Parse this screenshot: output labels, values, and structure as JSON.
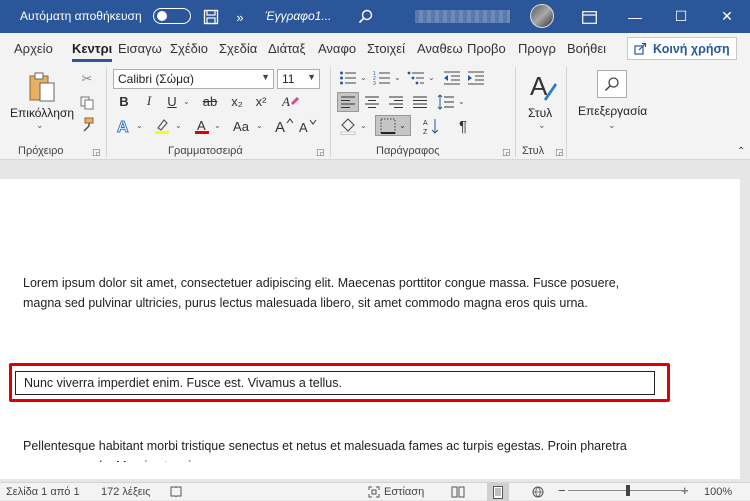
{
  "titlebar": {
    "autosave_label": "Αυτόματη αποθήκευση",
    "doc_title": "Έγγραφο1...",
    "save_icon": "save-icon",
    "more_icon": "chevron-double-right-icon",
    "search_icon": "search-icon",
    "minimize": "—",
    "restore": "☐",
    "close": "✕"
  },
  "tabs": {
    "items": [
      "Αρχείο",
      "Κεντρι",
      "Εισαγω",
      "Σχέδιο",
      "Σχεδία",
      "Διάταξ",
      "Αναφο",
      "Στοιχεί",
      "Αναθεω",
      "Προβο",
      "Προγρ",
      "Βοήθει"
    ],
    "active": "Κεντρι",
    "share_label": "Κοινή χρήση"
  },
  "ribbon": {
    "clipboard": {
      "paste_label": "Επικόλληση",
      "group_label": "Πρόχειρο"
    },
    "font": {
      "font_name": "Calibri (Σώμα)",
      "font_size": "11",
      "bold": "B",
      "italic": "I",
      "underline": "U",
      "strike": "ab",
      "subscript": "x₂",
      "superscript": "x²",
      "case_label": "Aa",
      "grow": "A^",
      "shrink": "Aˇ",
      "group_label": "Γραμματοσειρά",
      "highlight_color": "#ffff00",
      "font_color": "#e00000"
    },
    "paragraph": {
      "group_label": "Παράγραφος",
      "pilcrow": "¶"
    },
    "styles": {
      "label": "Στυλ",
      "group_label": "Στυλ"
    },
    "editing": {
      "label": "Επεξεργασία"
    }
  },
  "document": {
    "paragraph1": "Lorem ipsum dolor sit amet, consectetuer adipiscing elit. Maecenas porttitor congue massa. Fusce posuere, magna sed pulvinar ultricies, purus lectus malesuada libero, sit amet commodo magna eros quis urna.",
    "paragraph2": "Nunc viverra imperdiet enim. Fusce est. Vivamus a tellus.",
    "paragraph3": "Pellentesque habitant morbi tristique senectus et netus et malesuada fames ac turpis egestas. Proin pharetra nonummy pede. Mauris et orci."
  },
  "status": {
    "page": "Σελίδα 1 από 1",
    "words": "172 λέξεις",
    "focus": "Εστίαση",
    "zoom": "100%",
    "minus": "−",
    "plus": "+"
  },
  "colors": {
    "title_bar": "#2b579a",
    "highlight_border": "#e00000"
  }
}
